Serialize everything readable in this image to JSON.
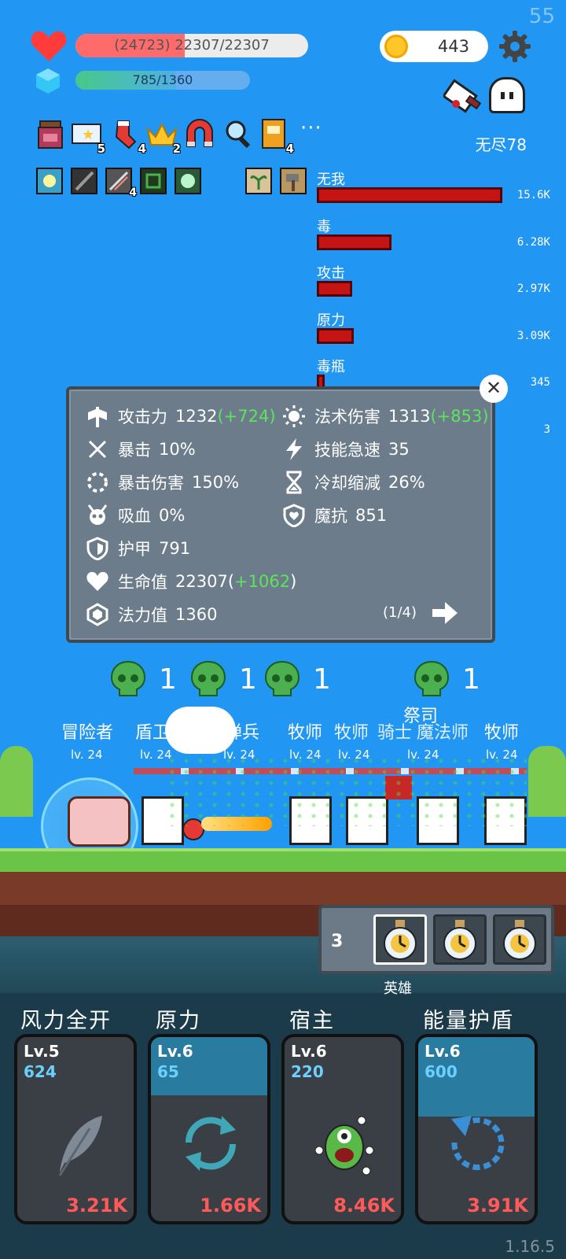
{
  "hud": {
    "fps": "55",
    "hp_text": "(24723) 22307/22307",
    "hp_fraction": 1.0,
    "hp_shield_fraction": 0.47,
    "mp_text": "785/1360",
    "mp_fraction": 0.577,
    "gold": "443",
    "mode_label": "无尽78"
  },
  "items": [
    {
      "icon": "jam-jar-icon",
      "count": ""
    },
    {
      "icon": "star-card-icon",
      "count": "5"
    },
    {
      "icon": "red-sock-icon",
      "count": "4"
    },
    {
      "icon": "crown-icon",
      "count": "2"
    },
    {
      "icon": "magnet-icon",
      "count": ""
    },
    {
      "icon": "magnifier-icon",
      "count": ""
    },
    {
      "icon": "book-icon",
      "count": "4"
    }
  ],
  "items_more": "···",
  "buffs": [
    {
      "icon": "light-burst-icon",
      "count": ""
    },
    {
      "icon": "dark-blade-icon",
      "count": ""
    },
    {
      "icon": "sword-slash-icon",
      "count": "4"
    },
    {
      "icon": "green-rune-icon",
      "count": ""
    },
    {
      "icon": "green-ghost-icon",
      "count": ""
    },
    {
      "icon": "sprout-icon",
      "count": ""
    },
    {
      "icon": "hammer-icon",
      "count": ""
    }
  ],
  "damage_chart": {
    "type": "bar",
    "categories": [
      "无我",
      "毒",
      "攻击",
      "原力",
      "毒瓶",
      ""
    ],
    "values": [
      15600,
      6280,
      2970,
      3090,
      345,
      3
    ],
    "labels": [
      "15.6K",
      "6.28K",
      "2.97K",
      "3.09K",
      "345",
      "3"
    ]
  },
  "stats": {
    "attack": {
      "label": "攻击力",
      "value": "1232",
      "bonus": "(+724)"
    },
    "crit": {
      "label": "暴击",
      "value": "10%"
    },
    "crit_damage": {
      "label": "暴击伤害",
      "value": "150%"
    },
    "lifesteal": {
      "label": "吸血",
      "value": "0%"
    },
    "armor": {
      "label": "护甲",
      "value": "791"
    },
    "hp": {
      "label": "生命值",
      "value": "22307",
      "bonus": "(+1062)"
    },
    "mana": {
      "label": "法力值",
      "value": "1360"
    },
    "magic_damage": {
      "label": "法术伤害",
      "value": "1313",
      "bonus": "(+853)"
    },
    "ability_haste": {
      "label": "技能急速",
      "value": "35"
    },
    "cdr": {
      "label": "冷却缩减",
      "value": "26%"
    },
    "magic_resist": {
      "label": "魔抗",
      "value": "851"
    },
    "page": "(1/4)"
  },
  "battle": {
    "skulls": [
      "1",
      "1",
      "1",
      "1"
    ],
    "names": [
      "冒险者",
      "盾卫",
      "掷弹兵",
      "牧师",
      "牧师",
      "骑士",
      "魔法师",
      "祭司",
      "牧师"
    ],
    "level": "lv. 24"
  },
  "tray": {
    "count": "3",
    "label": "英雄"
  },
  "skills": [
    {
      "title": "风力全开",
      "lv": "Lv.5",
      "cost": "624",
      "price": "3.21K",
      "icon": "feather-icon",
      "ready": 0.0
    },
    {
      "title": "原力",
      "lv": "Lv.6",
      "cost": "65",
      "price": "1.66K",
      "icon": "cycle-icon",
      "ready": 0.74
    },
    {
      "title": "宿主",
      "lv": "Lv.6",
      "cost": "220",
      "price": "8.46K",
      "icon": "green-monster-icon",
      "ready": 0.0
    },
    {
      "title": "能量护盾",
      "lv": "Lv.6",
      "cost": "600",
      "price": "3.91K",
      "icon": "refresh-arrow-icon",
      "ready": 0.49
    }
  ],
  "version": "1.16.5",
  "colors": {
    "sky": "#2196f3",
    "hp_fill": "#ff6b6b",
    "damage_bar": "#c41414",
    "bonus_green": "#5fe35f",
    "price_red": "#ff5a5a",
    "cost_blue": "#6cd0ff"
  }
}
